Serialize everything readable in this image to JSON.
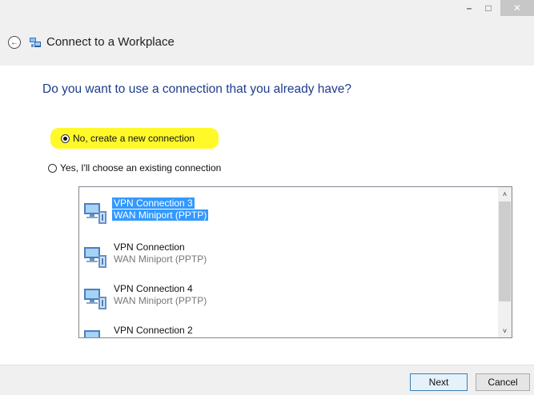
{
  "window": {
    "title": "Connect to a Workplace",
    "controls": {
      "minimize": "–",
      "maximize": "□",
      "close": "✕"
    }
  },
  "dialog": {
    "heading": "Do you want to use a connection that you already have?",
    "options": [
      {
        "label": "No, create a new connection",
        "selected": true,
        "highlighted": true
      },
      {
        "label": "Yes, I'll choose an existing connection",
        "selected": false
      }
    ],
    "connections": [
      {
        "name": "VPN Connection 3",
        "device": "WAN Miniport (PPTP)",
        "selected": true
      },
      {
        "name": "VPN Connection",
        "device": "WAN Miniport (PPTP)",
        "selected": false
      },
      {
        "name": "VPN Connection 4",
        "device": "WAN Miniport (PPTP)",
        "selected": false
      },
      {
        "name": "VPN Connection 2",
        "device": "",
        "selected": false
      }
    ],
    "scroll": {
      "up": "˄",
      "down": "˅"
    }
  },
  "buttons": {
    "next": "Next",
    "cancel": "Cancel"
  },
  "colors": {
    "heading": "#1e3c8c",
    "selection": "#3399ff",
    "highlight": "#fff92a"
  },
  "icons": {
    "back": "back-arrow-icon",
    "app": "network-workplace-icon",
    "connection": "vpn-connection-icon"
  }
}
